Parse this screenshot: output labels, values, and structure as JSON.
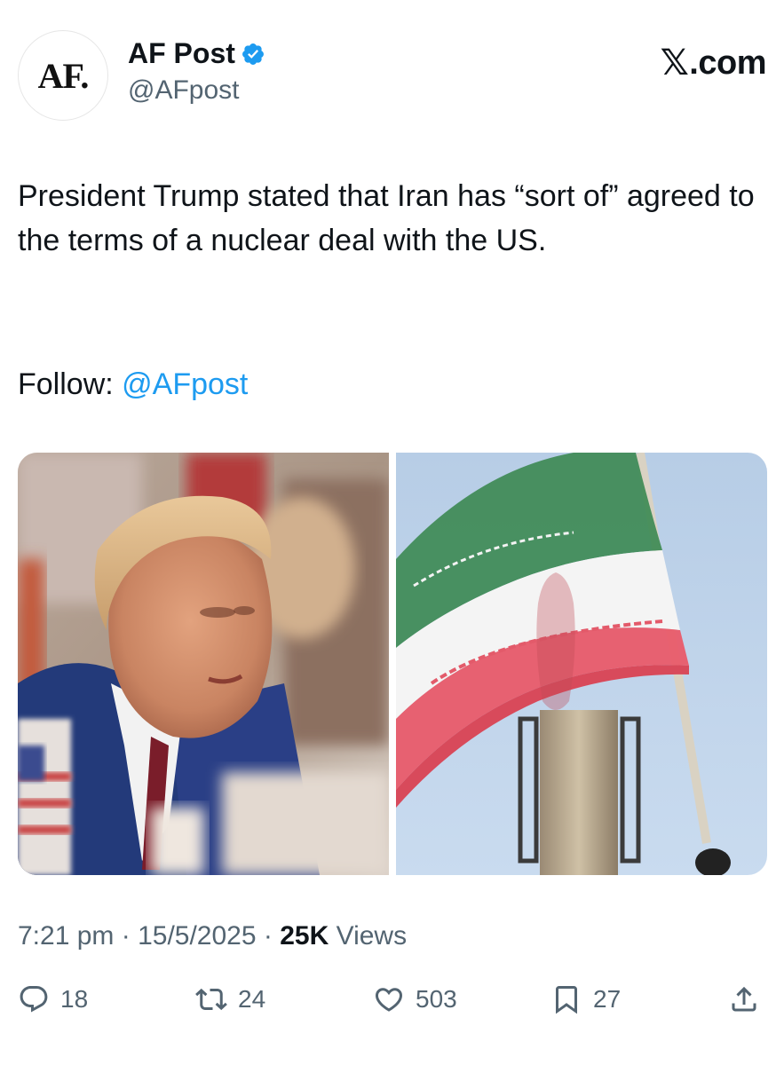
{
  "author": {
    "avatar_text": "AF.",
    "display_name": "AF Post",
    "handle": "@AFpost",
    "verified_icon": "verified-badge-icon",
    "verified_color": "#1d9bf0"
  },
  "brand": {
    "x_glyph": "𝕏",
    "suffix": ".com"
  },
  "tweet": {
    "text": "President Trump stated that Iran has “sort of” agreed to the terms of a nuclear deal with the US.",
    "follow_label": "Follow: ",
    "follow_mention": "@AFpost",
    "mention_color": "#1d9bf0"
  },
  "media": [
    {
      "name": "photo-trump",
      "icon": "photo-icon"
    },
    {
      "name": "photo-iran-flag",
      "icon": "photo-icon"
    }
  ],
  "meta": {
    "time": "7:21 pm",
    "separator": " · ",
    "date": "15/5/2025",
    "views_count": "25K",
    "views_label": " Views"
  },
  "actions": {
    "reply_count": "18",
    "repost_count": "24",
    "like_count": "503",
    "bookmark_count": "27"
  }
}
